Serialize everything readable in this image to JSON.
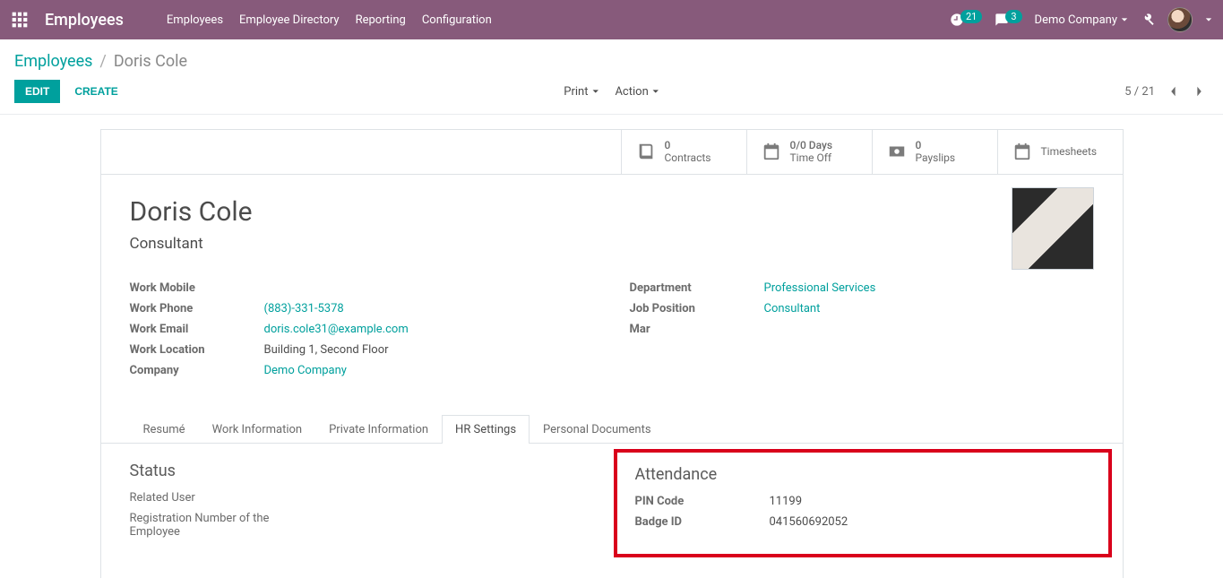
{
  "topbar": {
    "brand": "Employees",
    "menu": [
      "Employees",
      "Employee Directory",
      "Reporting",
      "Configuration"
    ],
    "activity_count": "21",
    "message_count": "3",
    "company": "Demo Company"
  },
  "breadcrumb": {
    "root": "Employees",
    "current": "Doris Cole"
  },
  "controls": {
    "edit": "EDIT",
    "create": "CREATE",
    "print": "Print",
    "action": "Action",
    "pager": "5 / 21"
  },
  "stats": {
    "contracts": {
      "num": "0",
      "label": "Contracts"
    },
    "timeoff": {
      "num": "0/0 Days",
      "label": "Time Off"
    },
    "payslips": {
      "num": "0",
      "label": "Payslips"
    },
    "timesheets": {
      "num": "",
      "label": "Timesheets"
    }
  },
  "employee": {
    "name": "Doris Cole",
    "title": "Consultant",
    "left": {
      "work_mobile_label": "Work Mobile",
      "work_mobile": "",
      "work_phone_label": "Work Phone",
      "work_phone": "(883)-331-5378",
      "work_email_label": "Work Email",
      "work_email": "doris.cole31@example.com",
      "work_location_label": "Work Location",
      "work_location": "Building 1, Second Floor",
      "company_label": "Company",
      "company": "Demo Company"
    },
    "right": {
      "department_label": "Department",
      "department": "Professional Services",
      "job_label": "Job Position",
      "job": "Consultant",
      "manager_label_cut": "Mar"
    }
  },
  "tabs": [
    "Resumé",
    "Work Information",
    "Private Information",
    "HR Settings",
    "Personal Documents"
  ],
  "hr": {
    "status_title": "Status",
    "related_user_label": "Related User",
    "reg_number_label": "Registration Number of the Employee",
    "attendance_title": "Attendance",
    "pin_label": "PIN Code",
    "pin": "11199",
    "badge_label": "Badge ID",
    "badge": "041560692052"
  }
}
